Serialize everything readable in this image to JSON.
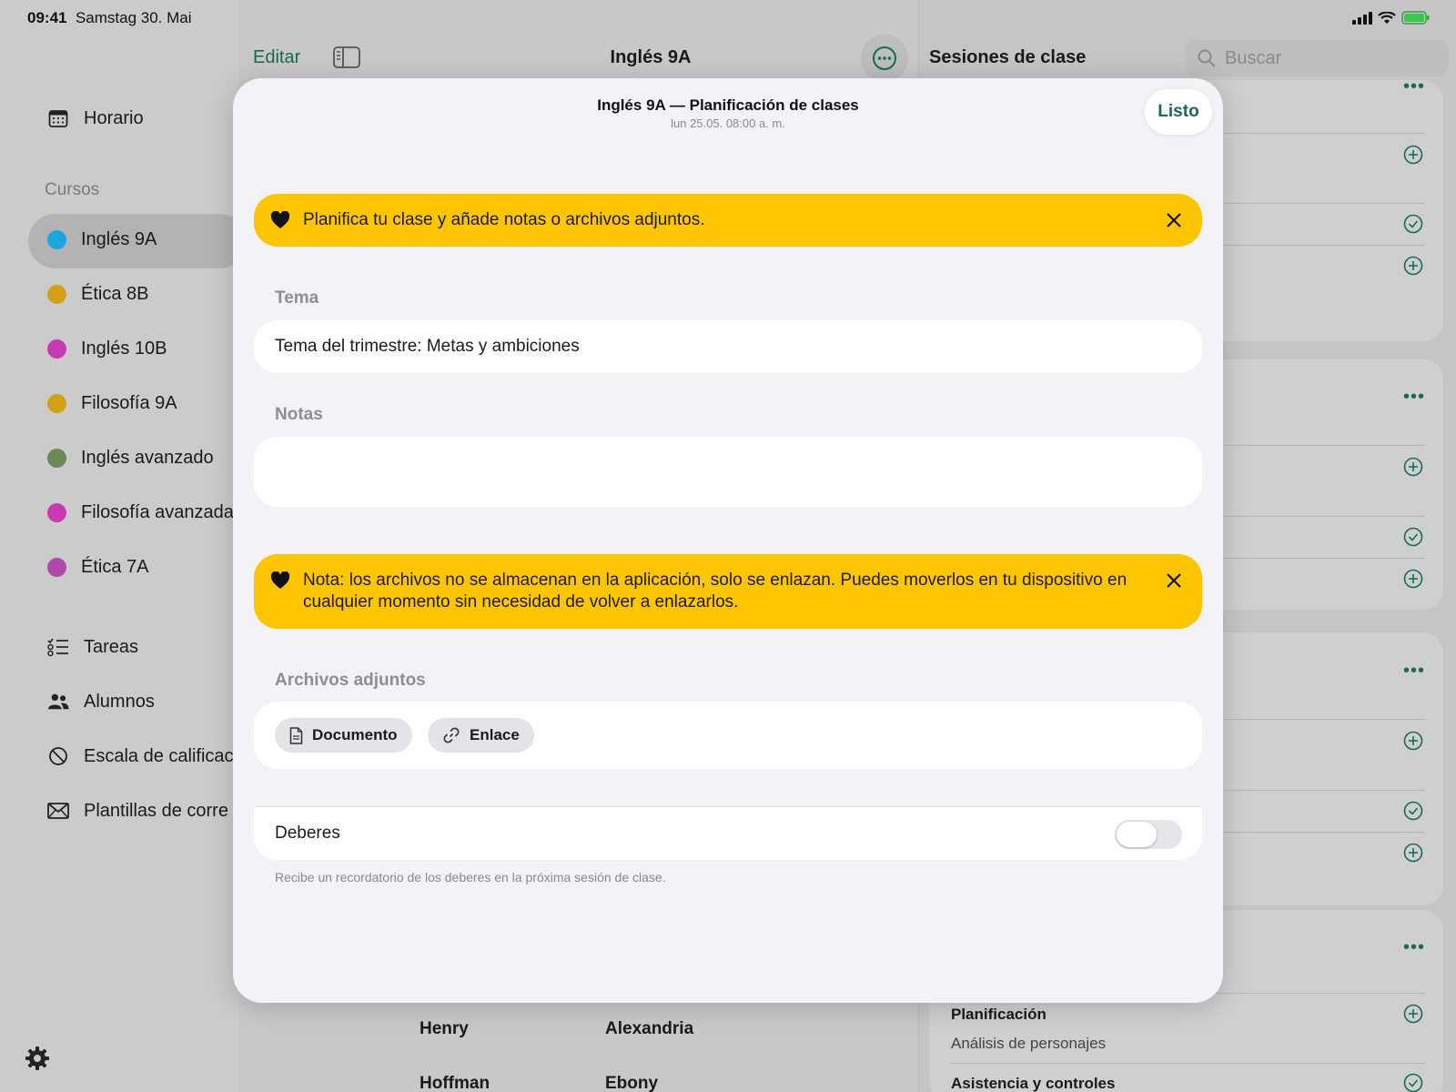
{
  "status_bar": {
    "time": "09:41",
    "date": "Samstag 30. Mai"
  },
  "sidebar": {
    "schedule_label": "Horario",
    "courses_section": "Cursos",
    "courses": [
      {
        "label": "Inglés 9A",
        "color": "#1aa6e0"
      },
      {
        "label": "Ética 8B",
        "color": "#d4a017"
      },
      {
        "label": "Inglés 10B",
        "color": "#c83ab0"
      },
      {
        "label": "Filosofía 9A",
        "color": "#d4a017"
      },
      {
        "label": "Inglés avanzado",
        "color": "#6b8a55"
      },
      {
        "label": "Filosofía avanzada",
        "color": "#c83ab0"
      },
      {
        "label": "Ética 7A",
        "color": "#b04aa8"
      }
    ],
    "links": [
      {
        "label": "Tareas",
        "icon": "checklist-icon"
      },
      {
        "label": "Alumnos",
        "icon": "people-icon"
      },
      {
        "label": "Escala de calificac",
        "icon": "grading-scale-icon"
      },
      {
        "label": "Plantillas de corre",
        "icon": "envelope-icon"
      }
    ]
  },
  "middle": {
    "edit_label": "Editar",
    "title": "Inglés 9A",
    "names": [
      "Henry",
      "Alexandria",
      "Hoffman",
      "Ebony"
    ]
  },
  "right_panel": {
    "title": "Sesiones de clase",
    "search_placeholder": "Buscar",
    "planning_label": "Planificación",
    "planning_value": "Análisis de personajes",
    "attendance_label": "Asistencia y controles"
  },
  "modal": {
    "title": "Inglés 9A — Planificación de clases",
    "subtitle": "lun 25.05. 08:00 a. m.",
    "done_label": "Listo",
    "banner_top": "Planifica tu clase y añade notas o archivos adjuntos.",
    "topic_label": "Tema",
    "topic_value": "Tema del trimestre: Metas y ambiciones",
    "notes_label": "Notas",
    "notes_value": "",
    "banner_files": "Nota: los archivos no se almacenan en la aplicación, solo se enlazan. Puedes moverlos en tu dispositivo en cualquier momento sin necesidad de volver a enlazarlos.",
    "attachments_label": "Archivos adjuntos",
    "document_button": "Documento",
    "link_button": "Enlace",
    "homework_label": "Deberes",
    "homework_enabled": false,
    "homework_hint": "Recibe un recordatorio de los deberes en la próxima sesión de clase."
  },
  "colors": {
    "accent": "#176a58",
    "banner": "#ffc600"
  }
}
